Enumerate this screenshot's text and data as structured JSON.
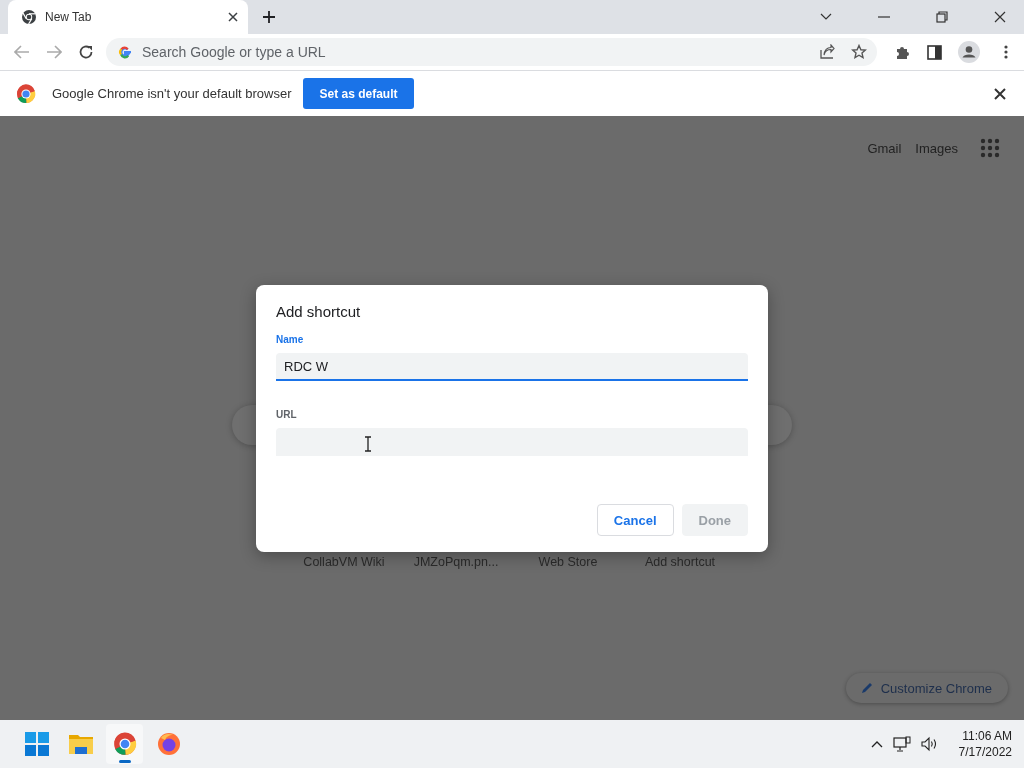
{
  "tabs": [
    {
      "title": "New Tab",
      "selected": true
    }
  ],
  "address_bar": {
    "placeholder": "Search Google or type a URL"
  },
  "infobar": {
    "message": "Google Chrome isn't your default browser",
    "button": "Set as default"
  },
  "page": {
    "top_links": [
      "Gmail",
      "Images"
    ],
    "shortcuts": [
      "CollabVM Wiki",
      "JMZoPqm.pn...",
      "Web Store",
      "Add shortcut"
    ],
    "customize_button": "Customize Chrome"
  },
  "dialog": {
    "title": "Add shortcut",
    "fields": [
      {
        "label": "Name",
        "value": "RDC W",
        "focused": true
      },
      {
        "label": "URL",
        "focused": false
      }
    ],
    "buttons": [
      {
        "label": "Cancel",
        "disabled": false
      },
      {
        "label": "Done",
        "disabled": true
      }
    ]
  },
  "taskbar": {
    "apps": [
      {
        "kind": "start",
        "selected": false
      },
      {
        "kind": "files",
        "selected": false
      },
      {
        "kind": "chrome",
        "selected": true
      },
      {
        "kind": "firefox",
        "selected": false
      }
    ],
    "time": "11:06 AM",
    "date": "7/17/2022"
  }
}
